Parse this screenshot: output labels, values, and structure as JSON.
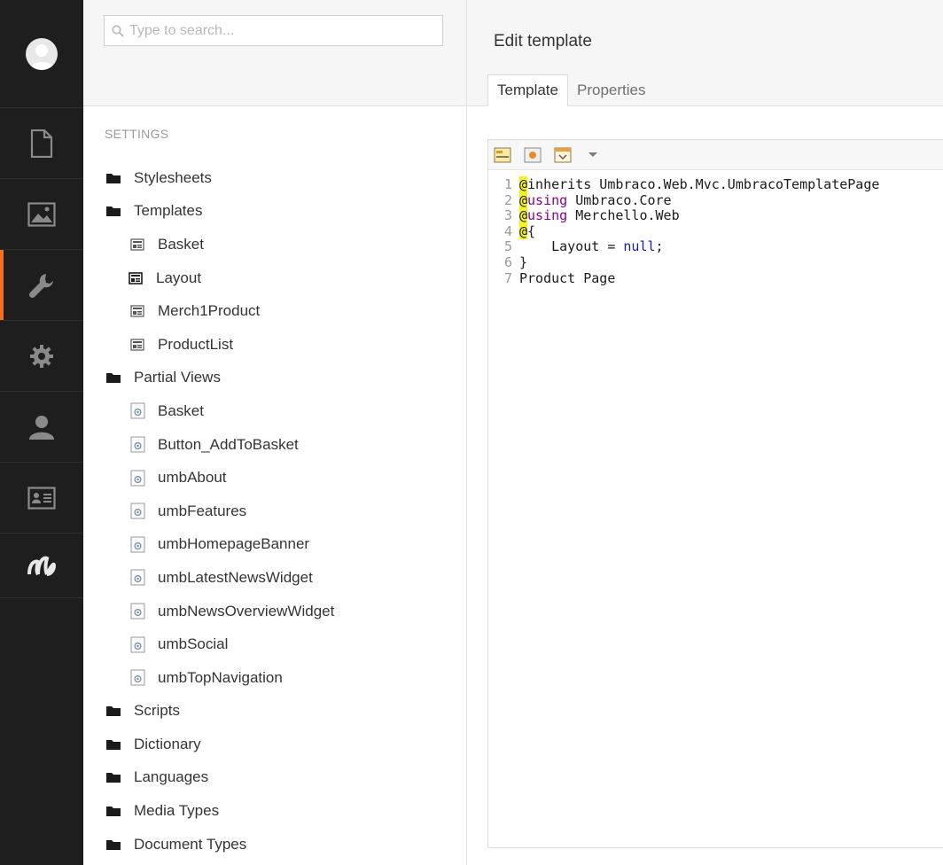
{
  "nav": {
    "items": [
      {
        "id": "content",
        "icon": "document-icon"
      },
      {
        "id": "media",
        "icon": "image-icon"
      },
      {
        "id": "settings",
        "icon": "wrench-icon",
        "active": true
      },
      {
        "id": "developer",
        "icon": "gear-icon"
      },
      {
        "id": "users",
        "icon": "user-icon"
      },
      {
        "id": "members",
        "icon": "member-card-icon"
      },
      {
        "id": "merchello",
        "icon": "merchello-logo-icon"
      }
    ],
    "accent_color": "#f36f21"
  },
  "search": {
    "placeholder": "Type to search..."
  },
  "tree": {
    "section_title": "SETTINGS",
    "nodes": [
      {
        "label": "Stylesheets",
        "type": "folder",
        "level": 0
      },
      {
        "label": "Templates",
        "type": "folder",
        "level": 0
      },
      {
        "label": "Basket",
        "type": "template",
        "level": 1
      },
      {
        "label": "Layout",
        "type": "template-master",
        "level": 1
      },
      {
        "label": "Merch1Product",
        "type": "template",
        "level": 1
      },
      {
        "label": "ProductList",
        "type": "template",
        "level": 1
      },
      {
        "label": "Partial Views",
        "type": "folder",
        "level": 0
      },
      {
        "label": "Basket",
        "type": "partial",
        "level": 1
      },
      {
        "label": "Button_AddToBasket",
        "type": "partial",
        "level": 1
      },
      {
        "label": "umbAbout",
        "type": "partial",
        "level": 1
      },
      {
        "label": "umbFeatures",
        "type": "partial",
        "level": 1
      },
      {
        "label": "umbHomepageBanner",
        "type": "partial",
        "level": 1
      },
      {
        "label": "umbLatestNewsWidget",
        "type": "partial",
        "level": 1
      },
      {
        "label": "umbNewsOverviewWidget",
        "type": "partial",
        "level": 1
      },
      {
        "label": "umbSocial",
        "type": "partial",
        "level": 1
      },
      {
        "label": "umbTopNavigation",
        "type": "partial",
        "level": 1
      },
      {
        "label": "Scripts",
        "type": "folder",
        "level": 0
      },
      {
        "label": "Dictionary",
        "type": "folder",
        "level": 0
      },
      {
        "label": "Languages",
        "type": "folder",
        "level": 0
      },
      {
        "label": "Media Types",
        "type": "folder",
        "level": 0
      },
      {
        "label": "Document Types",
        "type": "folder",
        "level": 0
      }
    ]
  },
  "editor": {
    "title": "Edit template",
    "tabs": [
      {
        "label": "Template",
        "active": true
      },
      {
        "label": "Properties",
        "active": false
      }
    ],
    "toolbar": [
      {
        "icon": "insert-field-icon"
      },
      {
        "icon": "insert-macro-icon"
      },
      {
        "icon": "insert-section-icon"
      },
      {
        "icon": "dropdown-arrow-icon"
      }
    ],
    "code": {
      "l1_num": "1",
      "l1_at": "@",
      "l1_rest": "inherits Umbraco.Web.Mvc.UmbracoTemplatePage",
      "l2_num": "2",
      "l2_at": "@",
      "l2_kw": "using",
      "l2_rest": " Umbraco.Core",
      "l3_num": "3",
      "l3_at": "@",
      "l3_kw": "using",
      "l3_rest": " Merchello.Web",
      "l4_num": "4",
      "l4_at": "@",
      "l4_rest": "{",
      "l5_num": "5",
      "l5_pre": "    Layout = ",
      "l5_null": "null",
      "l5_post": ";",
      "l6_num": "6",
      "l6_text": "}",
      "l7_num": "7",
      "l7_text": "Product Page"
    }
  }
}
